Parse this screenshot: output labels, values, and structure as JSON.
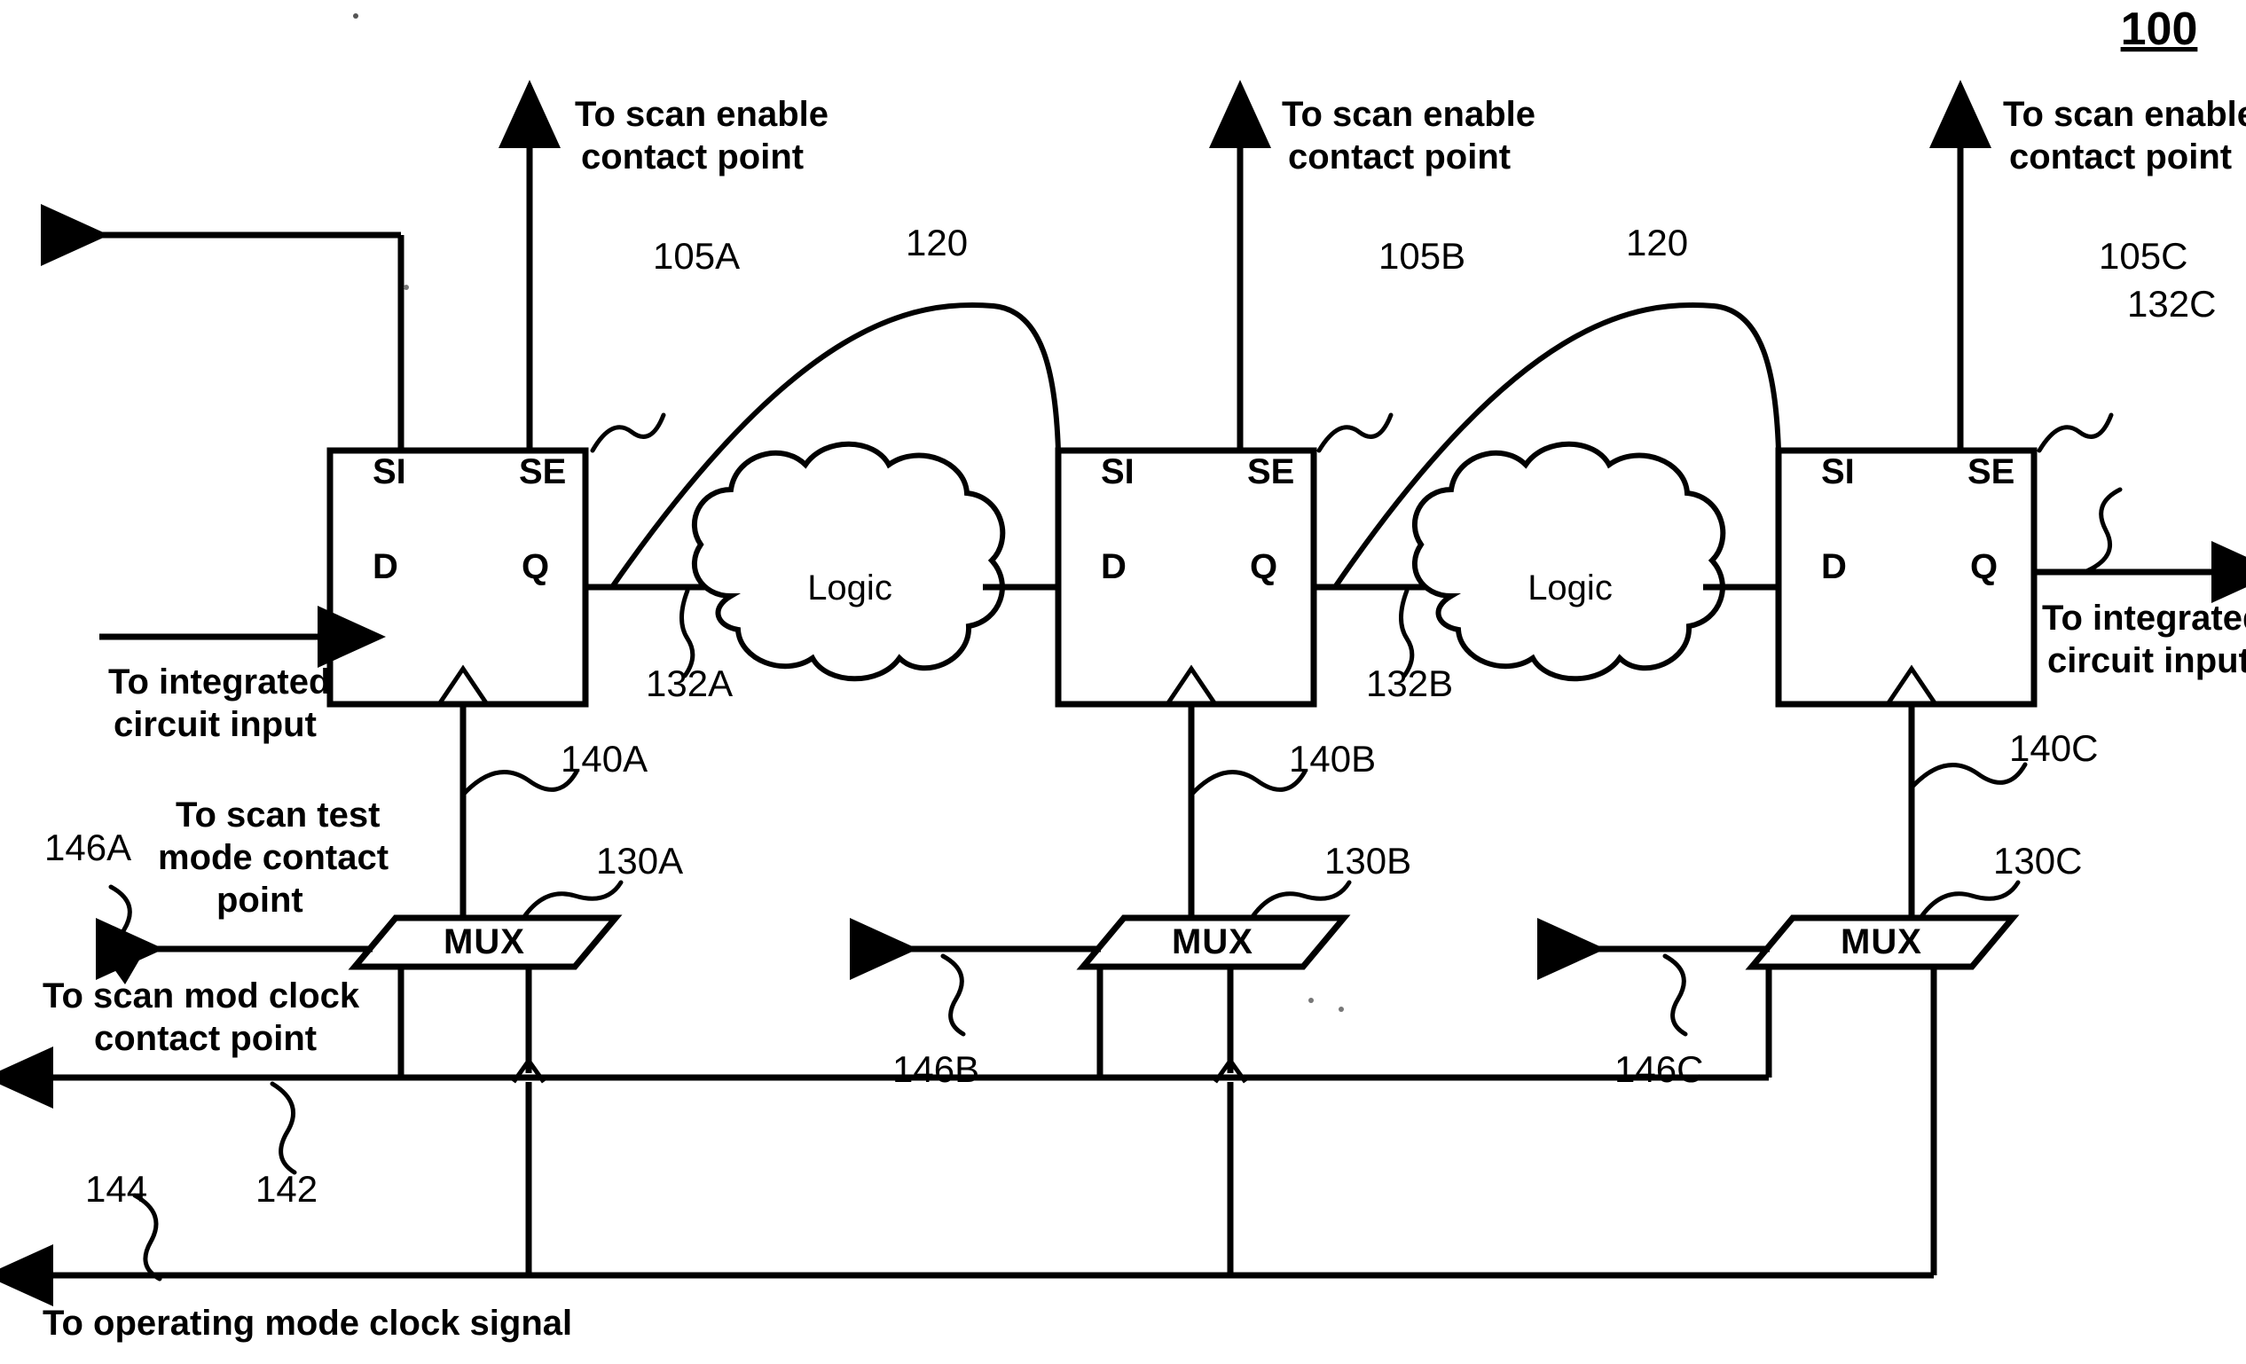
{
  "figure": {
    "number": "100",
    "type": "patent-circuit-diagram"
  },
  "flipflops": [
    {
      "id": "ff-a",
      "pins": {
        "si": "SI",
        "se": "SE",
        "d": "D",
        "q": "Q"
      },
      "ref_se": "105A",
      "ref_q": "132A",
      "ref_clk": "140A",
      "scan_enable_label": "To scan enable\ncontact point",
      "scan_enable_line1": "To scan enable",
      "scan_enable_line2": "contact point"
    },
    {
      "id": "ff-b",
      "pins": {
        "si": "SI",
        "se": "SE",
        "d": "D",
        "q": "Q"
      },
      "ref_se": "105B",
      "ref_q": "132B",
      "ref_clk": "140B",
      "scan_enable_line1": "To scan enable",
      "scan_enable_line2": "contact point"
    },
    {
      "id": "ff-c",
      "pins": {
        "si": "SI",
        "se": "SE",
        "d": "D",
        "q": "Q"
      },
      "ref_se": "105C",
      "ref_q": "132C",
      "ref_clk": "140C",
      "scan_enable_line1": "To scan enable",
      "scan_enable_line2": "contact point"
    }
  ],
  "logic_blocks": [
    {
      "id": "logic-1",
      "label": "Logic",
      "ref": "120"
    },
    {
      "id": "logic-2",
      "label": "Logic",
      "ref": "120"
    }
  ],
  "muxes": [
    {
      "id": "mux-a",
      "label": "MUX",
      "ref": "130A",
      "select_ref": "146A"
    },
    {
      "id": "mux-b",
      "label": "MUX",
      "ref": "130B",
      "select_ref": "146B"
    },
    {
      "id": "mux-c",
      "label": "MUX",
      "ref": "130C",
      "select_ref": "146C"
    }
  ],
  "buses": [
    {
      "id": "scan-mode-clock",
      "ref": "142",
      "label_line1": "To scan mod   clock",
      "label_line2": "contact point"
    },
    {
      "id": "operating-mode-clock",
      "ref": "144",
      "label": "To operating mode clock signal"
    }
  ],
  "io_labels": {
    "ic_input_left_line1": "To integrated",
    "ic_input_left_line2": "circuit input",
    "ic_input_right_line1": "To integrated",
    "ic_input_right_line2": "circuit input",
    "scan_test_mode_line1": "To scan test",
    "scan_test_mode_line2": "mode contact",
    "scan_test_mode_line3": "point"
  },
  "colors": {
    "ink": "#000000",
    "paper": "#ffffff"
  }
}
